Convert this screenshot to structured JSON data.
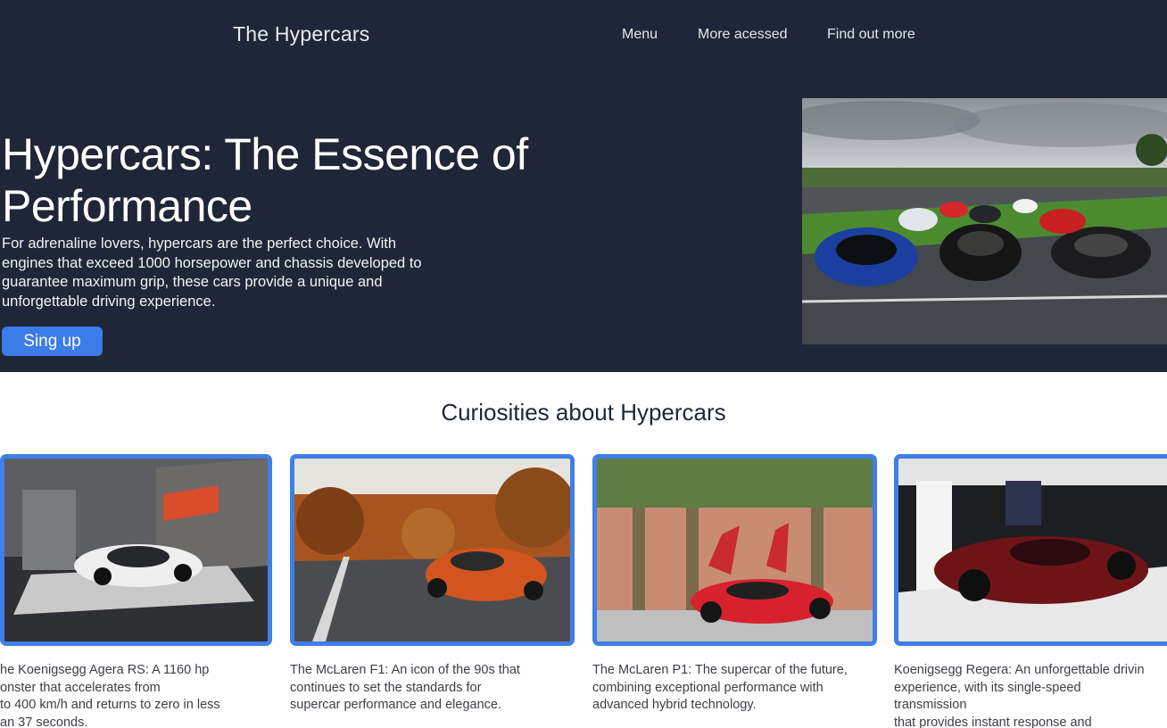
{
  "header": {
    "brand": "The Hypercars",
    "nav": [
      "Menu",
      "More acessed",
      "Find out more"
    ]
  },
  "hero": {
    "title": "Hypercars: The Essence of Performance",
    "text": "For adrenaline lovers, hypercars are the perfect choice. With engines that exceed 1000 horsepower and chassis developed to guarantee maximum grip, these cars provide a unique and unforgettable driving experience.",
    "button": "Sing up",
    "image": "photo-of-hypercars-lined-up-on-race-track"
  },
  "curiosities": {
    "title": "Curiosities about Hypercars",
    "cards": [
      {
        "image": "white-koenigsegg-agera-rs-in-showroom",
        "text": "he Koenigsegg Agera RS: A 1160 hp\nonster that accelerates from\nto 400 km/h and returns to zero in less\nan 37 seconds."
      },
      {
        "image": "orange-mclaren-f1-on-autumn-road",
        "text": "The McLaren F1: An icon of the 90s that\ncontinues to set the standards for\nsupercar performance and elegance."
      },
      {
        "image": "red-mclaren-p1-with-doors-open",
        "text": "The McLaren P1: The supercar of the future,\ncombining exceptional performance with\nadvanced hybrid technology."
      },
      {
        "image": "red-carbon-koenigsegg-regera-at-auto-show",
        "text": "Koenigsegg Regera: An unforgettable drivin\nexperience, with its single-speed\ntransmission\nthat provides instant response and"
      }
    ]
  },
  "colors": {
    "header_bg": "#1f2637",
    "accent": "#3f7fe6",
    "button": "#3b7ce8"
  }
}
